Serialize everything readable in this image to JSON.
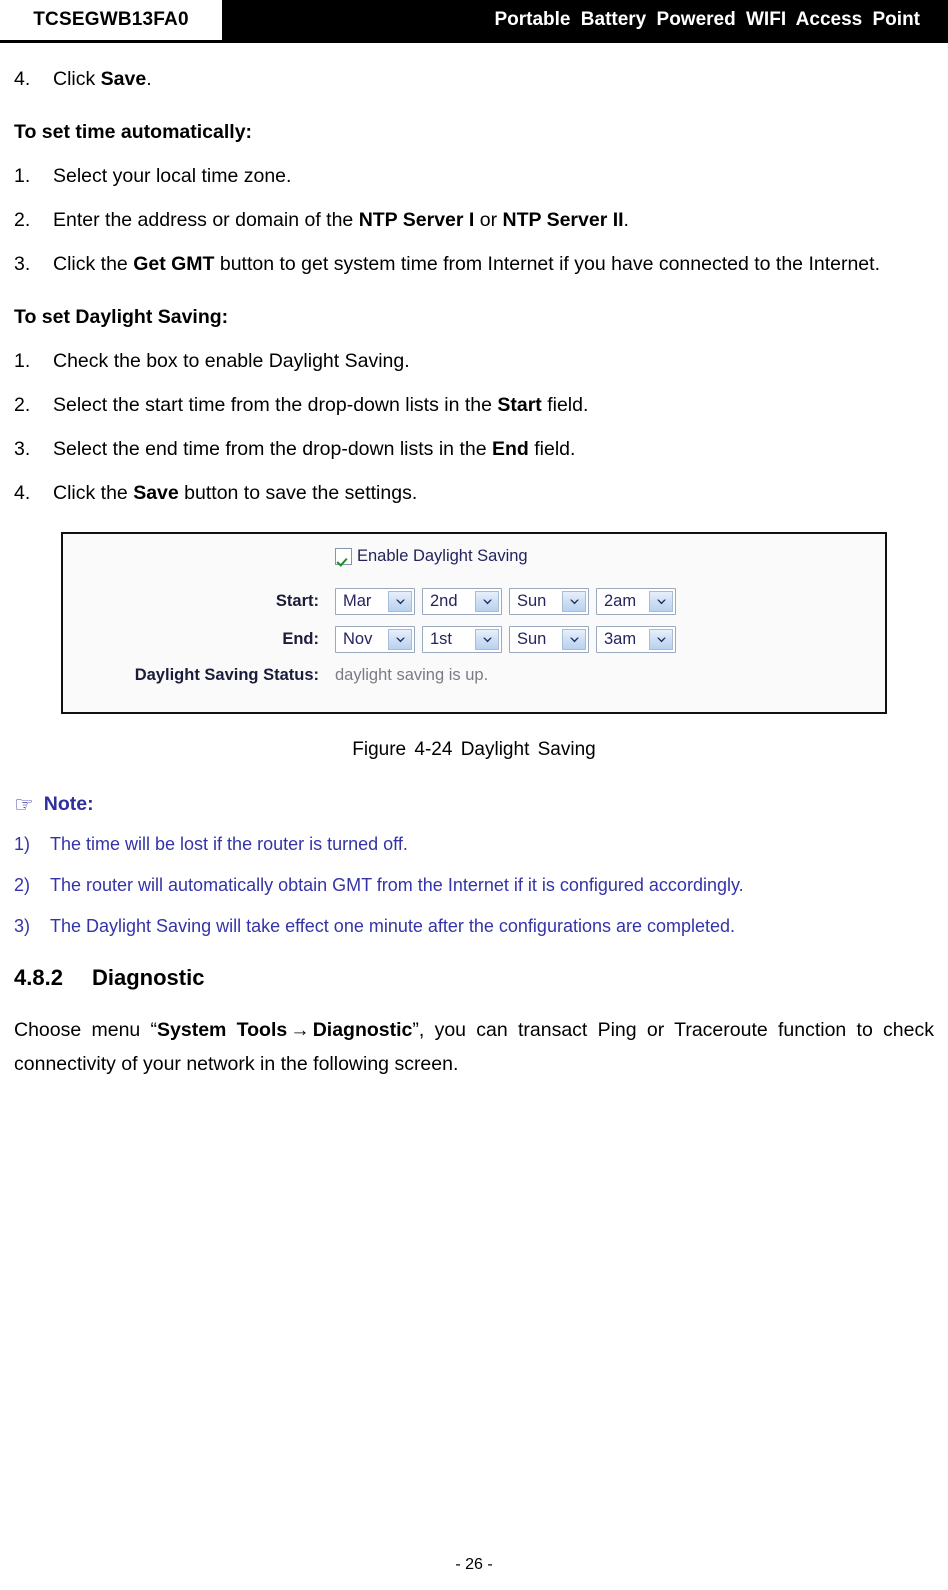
{
  "header": {
    "model": "TCSEGWB13FA0",
    "title": "Portable Battery Powered WIFI Access Point"
  },
  "body": {
    "step_prev": {
      "num": "4.",
      "text_before": "Click ",
      "bold": "Save",
      "text_after": "."
    },
    "auto_time": {
      "heading": "To set time automatically:",
      "items": [
        {
          "num": "1.",
          "segments": [
            {
              "text": "Select your local time zone.",
              "bold": false
            }
          ]
        },
        {
          "num": "2.",
          "segments": [
            {
              "text": "Enter the address or domain of the ",
              "bold": false
            },
            {
              "text": "NTP Server I",
              "bold": true
            },
            {
              "text": " or ",
              "bold": false
            },
            {
              "text": "NTP Server II",
              "bold": true
            },
            {
              "text": ".",
              "bold": false
            }
          ]
        },
        {
          "num": "3.",
          "segments": [
            {
              "text": "Click the ",
              "bold": false
            },
            {
              "text": "Get GMT",
              "bold": true
            },
            {
              "text": " button to get system time from Internet if you have connected to the Internet.",
              "bold": false
            }
          ]
        }
      ]
    },
    "daylight": {
      "heading": "To set Daylight Saving:",
      "items": [
        {
          "num": "1.",
          "segments": [
            {
              "text": "Check the box to enable Daylight Saving.",
              "bold": false
            }
          ]
        },
        {
          "num": "2.",
          "segments": [
            {
              "text": "Select the start time from the drop-down lists in the ",
              "bold": false
            },
            {
              "text": "Start",
              "bold": true
            },
            {
              "text": " field.",
              "bold": false
            }
          ]
        },
        {
          "num": "3.",
          "segments": [
            {
              "text": "Select the end time from the drop-down lists in the ",
              "bold": false
            },
            {
              "text": "End",
              "bold": true
            },
            {
              "text": " field.",
              "bold": false
            }
          ]
        },
        {
          "num": "4.",
          "segments": [
            {
              "text": "Click the ",
              "bold": false
            },
            {
              "text": "Save",
              "bold": true
            },
            {
              "text": " button to save the settings.",
              "bold": false
            }
          ]
        }
      ]
    }
  },
  "figure": {
    "enable_checkbox": {
      "label": "Enable Daylight Saving",
      "checked": true,
      "check_color": "#1f8a2c"
    },
    "start": {
      "label": "Start:",
      "selects": [
        {
          "name": "start-month",
          "value": "Mar"
        },
        {
          "name": "start-week",
          "value": "2nd"
        },
        {
          "name": "start-day",
          "value": "Sun"
        },
        {
          "name": "start-hour",
          "value": "2am"
        }
      ]
    },
    "end": {
      "label": "End:",
      "selects": [
        {
          "name": "end-month",
          "value": "Nov"
        },
        {
          "name": "end-week",
          "value": "1st"
        },
        {
          "name": "end-day",
          "value": "Sun"
        },
        {
          "name": "end-hour",
          "value": "3am"
        }
      ]
    },
    "status": {
      "label": "Daylight Saving Status:",
      "value": "daylight saving is up."
    },
    "caption": "Figure 4-24    Daylight Saving"
  },
  "note": {
    "icon": "pointing-hand-icon",
    "icon_glyph": "☞",
    "heading": "Note:",
    "color": "#3434a8",
    "items": [
      {
        "num": "1)",
        "text": "The time will be lost if the router is turned off."
      },
      {
        "num": "2)",
        "text": "The router will automatically obtain GMT from the Internet if it is configured accordingly."
      },
      {
        "num": "3)",
        "text": "The Daylight Saving will take effect one minute after the configurations are completed."
      }
    ]
  },
  "section": {
    "number": "4.8.2",
    "title": "Diagnostic",
    "paragraph": {
      "p1": "Choose menu “",
      "menu1": "System Tools",
      "arrow": "→",
      "menu2": "Diagnostic",
      "p2": "”, you can transact Ping or Traceroute function to check connectivity of your network in the following screen."
    }
  },
  "footer": {
    "page_label": "- 26 -"
  }
}
